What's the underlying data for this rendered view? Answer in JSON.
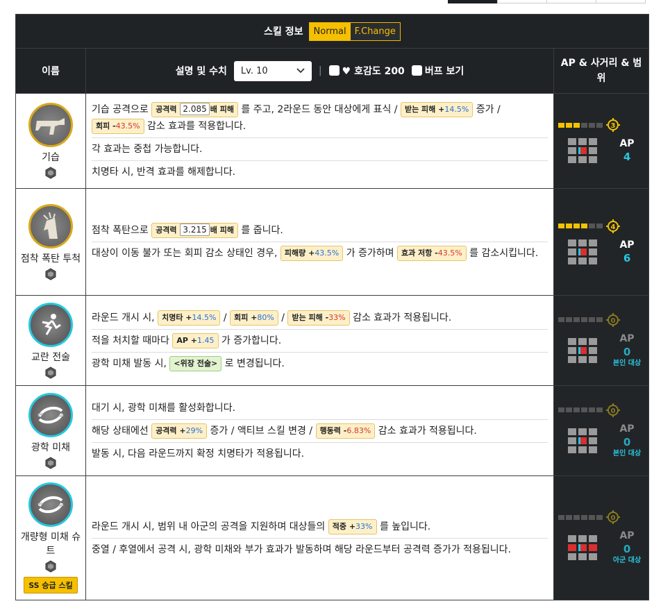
{
  "header": {
    "title": "스킬 정보",
    "mode_normal": "Normal",
    "mode_fchange": "F.Change",
    "col_name": "이름",
    "col_desc": "설명 및 수치",
    "level_value": "Lv. 10",
    "affinity_label": "♥ 호감도 200",
    "buff_label": "버프 보기",
    "col_ap": "AP & 사거리 & 범위"
  },
  "colors": {
    "accent": "#f6c000",
    "dark": "#1f2326",
    "cyan": "#27c7e0",
    "positive": "#2d6fd6",
    "negative": "#d9352c"
  },
  "skills": [
    {
      "name": "기습",
      "icon": "rifle-icon",
      "l1a": "기습 공격으로 ",
      "c1": "공격력",
      "c1n": "2.085",
      "c1s": "배 피해",
      "l1b": " 를 주고, 2라운드 동안 대상에게 표식 / ",
      "c2": "받는 피해 +",
      "c2v": "14.5%",
      "l1c": " 증가 / ",
      "c3": "회피 -",
      "c3v": "43.5%",
      "l1d": " 감소 효과를 적용합니다.",
      "l2": "각 효과는 중첩 가능합니다.",
      "l3": "치명타 시, 반격 효과를 해제합니다.",
      "range": "3",
      "ap_label": "AP",
      "ap": "4"
    },
    {
      "name": "점착 폭탄 투척",
      "icon": "bomb-icon",
      "l1a": "점착 폭탄으로 ",
      "c1": "공격력",
      "c1n": "3.215",
      "c1s": "배 피해",
      "l1b": " 를 줍니다.",
      "l2a": "대상이 이동 불가 또는 회피 감소 상태인 경우, ",
      "c2": "피해량 +",
      "c2v": "43.5%",
      "l2b": " 가 증가하며 ",
      "c3": "효과 저항 -",
      "c3v": "43.5%",
      "l2c": " 를 감소시킵니다.",
      "range": "4",
      "ap_label": "AP",
      "ap": "6"
    },
    {
      "name": "교란 전술",
      "icon": "runner-icon",
      "l1a": "라운드 개시 시, ",
      "c1": "치명타 +",
      "c1v": "14.5%",
      "s1": " / ",
      "c2": "회피 +",
      "c2v": "80%",
      "s2": " / ",
      "c3": "받는 피해 -",
      "c3v": "33%",
      "l1b": " 감소 효과가 적용됩니다.",
      "l2a": "적을 처치할 때마다 ",
      "c4": "AP +",
      "c4v": "1.45",
      "l2b": " 가 증가합니다.",
      "l3a": "광학 미채 발동 시, ",
      "c5": "<위장 전술>",
      "l3b": " 로 변경됩니다.",
      "range": "0",
      "ap_label": "AP",
      "ap": "0",
      "target": "본인 대상"
    },
    {
      "name": "광학 미채",
      "icon": "camo-icon",
      "l1": "대기 시, 광학 미채를 활성화합니다.",
      "l2a": "해당 상태에선 ",
      "c1": "공격력 +",
      "c1v": "29%",
      "l2b": " 증가 / 액티브 스킬 변경 / ",
      "c2": "행동력 -",
      "c2v": "6.83%",
      "l2c": " 감소 효과가 적용됩니다.",
      "l3": "발동 시, 다음 라운드까지 확정 치명타가 적용됩니다.",
      "range": "0",
      "ap_label": "AP",
      "ap": "0",
      "target": "본인 대상"
    },
    {
      "name": "개량형 미채 슈트",
      "icon": "suit-icon",
      "badge": "SS 승급 스킬",
      "l1a": "라운드 개시 시, 범위 내 아군의 공격을 지원하며 대상들의 ",
      "c1": "적중 +",
      "c1v": "33%",
      "l1b": " 를 높입니다.",
      "l2": "중열 / 후열에서 공격 시, 광학 미채와 부가 효과가 발동하며 해당 라운드부터 공격력 증가가 적용됩니다.",
      "range": "0",
      "ap_label": "AP",
      "ap": "0",
      "target": "아군 대상"
    }
  ]
}
